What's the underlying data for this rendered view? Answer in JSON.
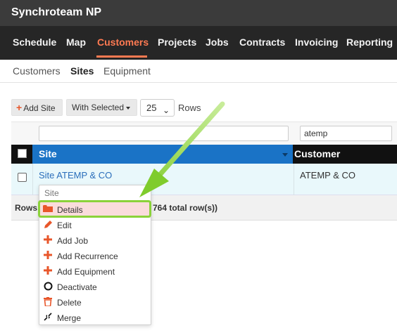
{
  "app": {
    "title": "Synchroteam NP"
  },
  "nav": {
    "items": [
      {
        "label": "Schedule"
      },
      {
        "label": "Map"
      },
      {
        "label": "Customers",
        "active": true
      },
      {
        "label": "Projects"
      },
      {
        "label": "Jobs"
      },
      {
        "label": "Contracts"
      },
      {
        "label": "Invoicing"
      },
      {
        "label": "Reporting"
      }
    ]
  },
  "subnav": {
    "items": [
      {
        "label": "Customers"
      },
      {
        "label": "Sites",
        "active": true
      },
      {
        "label": "Equipment"
      }
    ]
  },
  "toolbar": {
    "add_site_label": "Add Site",
    "with_selected_label": "With Selected",
    "rows_per_page": "25",
    "rows_label": "Rows"
  },
  "grid": {
    "filters": {
      "site": "",
      "customer": "atemp"
    },
    "columns": [
      {
        "label": "Site"
      },
      {
        "label": "Customer"
      }
    ],
    "rows": [
      {
        "site": "Site ATEMP & CO",
        "customer": "ATEMP & CO"
      }
    ],
    "footer": {
      "rows_label": "Rows",
      "total_text": "764 total row(s))"
    }
  },
  "context_menu": {
    "header": "Site",
    "items": [
      {
        "label": "Details",
        "icon": "folder-icon",
        "highlighted": true
      },
      {
        "label": "Edit",
        "icon": "pencil-icon"
      },
      {
        "label": "Add Job",
        "icon": "plus-icon"
      },
      {
        "label": "Add Recurrence",
        "icon": "plus-icon"
      },
      {
        "label": "Add Equipment",
        "icon": "plus-icon"
      },
      {
        "label": "Deactivate",
        "icon": "circle-icon"
      },
      {
        "label": "Delete",
        "icon": "trash-icon"
      },
      {
        "label": "Merge",
        "icon": "merge-arrows-icon"
      }
    ]
  },
  "colors": {
    "accent": "#ff7a52",
    "header_blue": "#1a73c6",
    "link": "#2a6ebb",
    "highlight_green": "#8bd23a",
    "icon_red": "#e8562a"
  }
}
